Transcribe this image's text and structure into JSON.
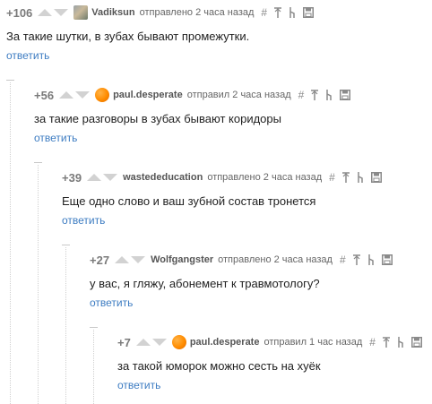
{
  "comments": [
    {
      "rating": "+106",
      "username": "Vadiksun",
      "meta": "отправлено 2 часа назад",
      "text": "За такие шутки, в зубах бывают промежутки.",
      "reply": "ответить",
      "avatar": "picture"
    },
    {
      "rating": "+56",
      "username": "paul.desperate",
      "meta": "отправил 2 часа назад",
      "text": "за такие разговоры в зубах бывают коридоры",
      "reply": "ответить",
      "avatar": "orange"
    },
    {
      "rating": "+39",
      "username": "wastededucation",
      "meta": "отправлено 2 часа назад",
      "text": "Еще одно слово и ваш зубной состав тронется",
      "reply": "ответить",
      "avatar": "none"
    },
    {
      "rating": "+27",
      "username": "Wolfgangster",
      "meta": "отправлено 2 часа назад",
      "text": "у вас, я гляжу, абонемент к травмотологу?",
      "reply": "ответить",
      "avatar": "none"
    },
    {
      "rating": "+7",
      "username": "paul.desperate",
      "meta": "отправил 1 час назад",
      "text": "за такой юморок можно сесть на хуёк",
      "reply": "ответить",
      "avatar": "orange"
    }
  ],
  "icons": {
    "vote_up": "arrow-up-icon",
    "vote_down": "arrow-down-icon",
    "hash": "hash-icon",
    "pin": "pin-icon",
    "branch": "branch-icon",
    "save": "save-icon",
    "collapse": "collapse-icon"
  },
  "colors": {
    "reply_link": "#3d7cc2",
    "avatar_orange": "#ff8c00",
    "rating": "#7a7a7a"
  }
}
